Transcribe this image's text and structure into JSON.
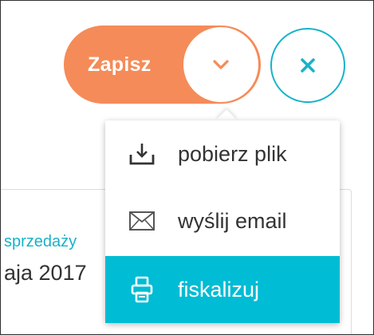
{
  "colors": {
    "save_accent": "#f58b58",
    "close_accent": "#16b3c9",
    "menu_active": "#00bcd4"
  },
  "background_form": {
    "field_label": "sprzedaży",
    "field_value": "aja 2017"
  },
  "toolbar": {
    "save_label": "Zapisz",
    "toggle_icon": "chevron-down-icon",
    "close_icon": "close-icon"
  },
  "menu": {
    "items": [
      {
        "label": "pobierz plik",
        "icon": "download-icon",
        "active": false
      },
      {
        "label": "wyślij email",
        "icon": "envelope-icon",
        "active": false
      },
      {
        "label": "fiskalizuj",
        "icon": "printer-icon",
        "active": true
      }
    ]
  }
}
